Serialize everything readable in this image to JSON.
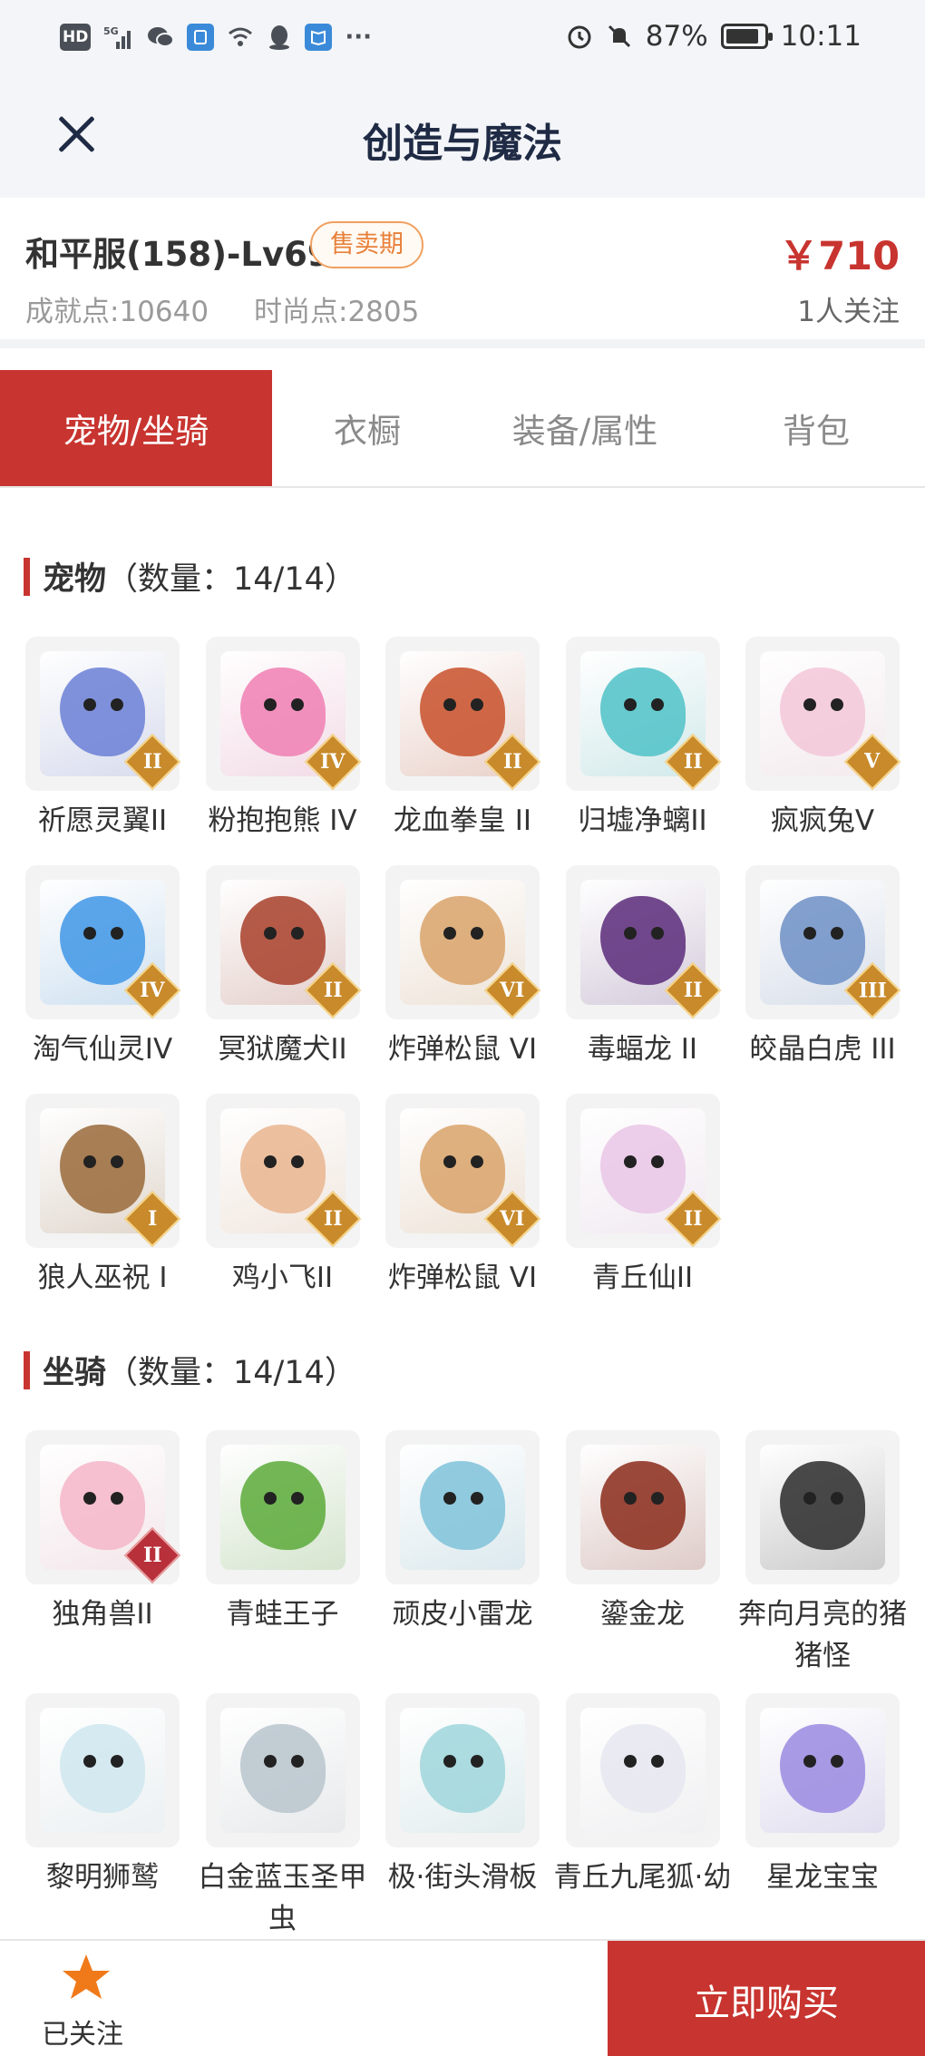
{
  "status_bar": {
    "left_icons": [
      "HD",
      "5G",
      "wechat-icon",
      "app-icon",
      "wifi-icon",
      "qq-icon",
      "book-icon",
      "···"
    ],
    "battery": "87%",
    "battery_level": 0.87,
    "time": "10:11"
  },
  "header": {
    "title": "创造与魔法"
  },
  "summary": {
    "account_name": "和平服(158)-Lv69",
    "badge": "售卖期",
    "achievement": "成就点:10640",
    "fashion": "时尚点:2805",
    "price": "￥710",
    "followers": "1人关注"
  },
  "tabs": [
    {
      "label": "宠物/坐骑",
      "active": true
    },
    {
      "label": "衣橱",
      "active": false
    },
    {
      "label": "装备/属性",
      "active": false
    },
    {
      "label": "背包",
      "active": false
    }
  ],
  "pets_section": {
    "title": "宠物",
    "count": "（数量：14/14）",
    "items": [
      {
        "name": "祈愿灵翼II",
        "tier": "II",
        "color": "#6b7fd6"
      },
      {
        "name": "粉抱抱熊 IV",
        "tier": "IV",
        "color": "#f07fb3"
      },
      {
        "name": "龙血拳皇 II",
        "tier": "II",
        "color": "#c8502a"
      },
      {
        "name": "归墟净螭II",
        "tier": "II",
        "color": "#4fc2c8"
      },
      {
        "name": "疯疯兔V",
        "tier": "V",
        "color": "#f3c7d8"
      },
      {
        "name": "淘气仙灵IV",
        "tier": "IV",
        "color": "#3f97e6"
      },
      {
        "name": "冥狱魔犬II",
        "tier": "II",
        "color": "#a8402a"
      },
      {
        "name": "炸弹松鼠 VI",
        "tier": "VI",
        "color": "#d9a36a"
      },
      {
        "name": "毒蝠龙 II",
        "tier": "II",
        "color": "#5a2a7a"
      },
      {
        "name": "皎晶白虎 III",
        "tier": "III",
        "color": "#6d8fc6"
      },
      {
        "name": "狼人巫祝 I",
        "tier": "I",
        "color": "#9a6a3a"
      },
      {
        "name": "鸡小飞II",
        "tier": "II",
        "color": "#e9b58f"
      },
      {
        "name": "炸弹松鼠 VI",
        "tier": "VI",
        "color": "#d9a36a"
      },
      {
        "name": "青丘仙II",
        "tier": "II",
        "color": "#e9c6e6"
      }
    ]
  },
  "mounts_section": {
    "title": "坐骑",
    "count": "（数量：14/14）",
    "items": [
      {
        "name": "独角兽II",
        "tier": "II",
        "color": "#f4b6c9"
      },
      {
        "name": "青蛙王子",
        "tier": "",
        "color": "#5caa3a"
      },
      {
        "name": "顽皮小雷龙",
        "tier": "",
        "color": "#7fc2d9"
      },
      {
        "name": "鎏金龙",
        "tier": "",
        "color": "#8a2a1a"
      },
      {
        "name": "奔向月亮的猪猪怪",
        "tier": "",
        "color": "#2a2a2a"
      },
      {
        "name": "黎明狮鹫",
        "tier": "",
        "color": "#cfe6ef"
      },
      {
        "name": "白金蓝玉圣甲虫",
        "tier": "",
        "color": "#b9c4cc"
      },
      {
        "name": "极·街头滑板",
        "tier": "",
        "color": "#9fd6dc"
      },
      {
        "name": "青丘九尾狐·幼",
        "tier": "",
        "color": "#e6e6f0"
      },
      {
        "name": "星龙宝宝",
        "tier": "",
        "color": "#9a8ae0"
      }
    ]
  },
  "bottom_bar": {
    "follow_label": "已关注",
    "buy_label": "立即购买",
    "accent": "#c8342f",
    "star_color": "#f07a1a"
  }
}
